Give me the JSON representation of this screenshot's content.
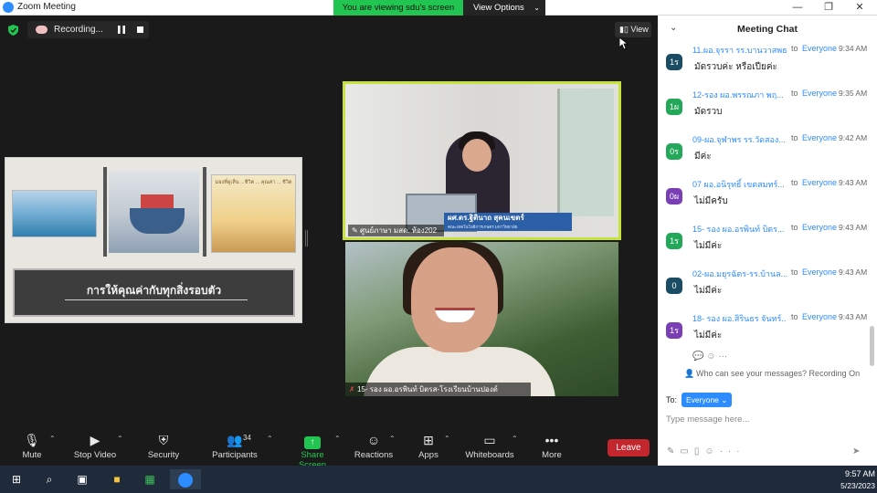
{
  "window": {
    "title": "Zoom Meeting",
    "viewing_banner": "You are viewing sdu's screen",
    "view_options": "View Options",
    "minimize_glyph": "—",
    "maximize_glyph": "❐",
    "close_glyph": "✕"
  },
  "meeting": {
    "recording_label": "Recording...",
    "view_button": "View",
    "shared_slide": {
      "caption": "การให้คุณค่ากับทุกสิ่งรอบตัว",
      "sunset_text": "มองที่ดูเห็น ...ชีวิต ... คุณค่า ... ชีวิต"
    },
    "video_top": {
      "name_plate": "ผศ.ดร.ฐิตินาถ สุคนเขตร์",
      "plate_sub": "คณะเทคโนโลยีการเกษตร มหาวิทยาลัย",
      "participant_label": "ศูนย์ภาษา มสด. ห้อง202"
    },
    "video_bottom": {
      "participant_label": "15- รอง ผอ.อรพินท์ บิตรส-โรงเรียนบ้านปองด์"
    }
  },
  "toolbar": {
    "mute": "Mute",
    "stop_video": "Stop Video",
    "security": "Security",
    "participants": "Participants",
    "participants_count": "34",
    "share_screen": "Share Screen",
    "reactions": "Reactions",
    "apps": "Apps",
    "whiteboards": "Whiteboards",
    "more": "More",
    "leave": "Leave"
  },
  "chat": {
    "title": "Meeting Chat",
    "messages": [
      {
        "avatar": "1ร",
        "avatar_color": "#1a4d63",
        "sender": "11.ผอ.จุรรา รร.บานวาสพธ",
        "to": "to",
        "recipient": "Everyone",
        "time": "9:34 AM",
        "text": "มัดรวบค่ะ หรือเปียค่ะ"
      },
      {
        "avatar": "1ผ",
        "avatar_color": "#23a85a",
        "sender": "12-รอง ผอ.พรรณภา พฤ...",
        "to": "to",
        "recipient": "Everyone",
        "time": "9:35 AM",
        "text": "มัดรวบ"
      },
      {
        "avatar": "0ร",
        "avatar_color": "#23a85a",
        "sender": "09-ผอ.จุฬาพร รร.วัดสอง...",
        "to": "to",
        "recipient": "Everyone",
        "time": "9:42 AM",
        "text": "มีค่ะ"
      },
      {
        "avatar": "0ผ",
        "avatar_color": "#7a3fb5",
        "sender": "07 ผอ.อนิรุทธิ์ เขตสมทร์...",
        "to": "to",
        "recipient": "Everyone",
        "time": "9:43 AM",
        "text": "ไม่มีครับ"
      },
      {
        "avatar": "1ร",
        "avatar_color": "#23a85a",
        "sender": "15- รอง ผอ.อรพินท์ บิตร...",
        "to": "to",
        "recipient": "Everyone",
        "time": "9:43 AM",
        "text": "ไม่มีค่ะ"
      },
      {
        "avatar": "0",
        "avatar_color": "#1a4d63",
        "sender": "02-ผอ.มยุรฉัตร-รร.บ้านล...",
        "to": "to",
        "recipient": "Everyone",
        "time": "9:43 AM",
        "text": "ไม่มีค่ะ"
      },
      {
        "avatar": "1ร",
        "avatar_color": "#7a3fb5",
        "sender": "18- รอง ผอ.สิรินธร จันทร์...",
        "to": "to",
        "recipient": "Everyone",
        "time": "9:43 AM",
        "text": "ไม่มีค่ะ"
      }
    ],
    "privacy_note": "Who can see your messages? Recording On",
    "to_label": "To:",
    "to_target": "Everyone",
    "input_placeholder": "Type message here..."
  },
  "taskbar": {
    "clock_time": "9:57 AM",
    "clock_date": "5/23/2023",
    "icons": [
      "windows-start-icon",
      "search-icon",
      "task-view-icon",
      "file-explorer-icon",
      "app-grid-icon",
      "zoom-icon"
    ]
  },
  "colors": {
    "accent_green": "#23c552",
    "zoom_blue": "#2d8cff",
    "leave_red": "#c4262e",
    "active_speaker_border": "#c7e23a"
  }
}
